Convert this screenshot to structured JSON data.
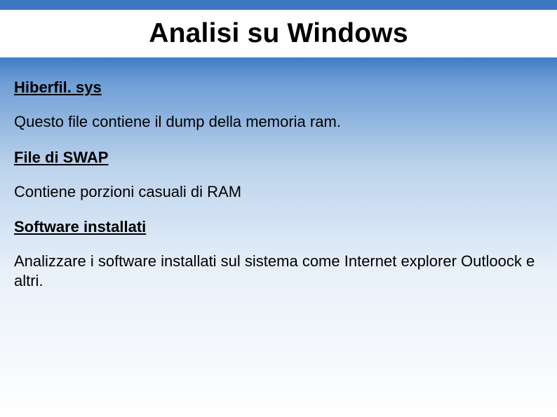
{
  "title": "Analisi su Windows",
  "sections": [
    {
      "heading": "Hiberfil. sys",
      "body": "Questo file contiene il dump della memoria ram."
    },
    {
      "heading": "File di SWAP",
      "body": "Contiene porzioni casuali di RAM"
    },
    {
      "heading": "Software installati",
      "body": "Analizzare i software installati sul sistema come Internet explorer Outloock e altri."
    }
  ]
}
